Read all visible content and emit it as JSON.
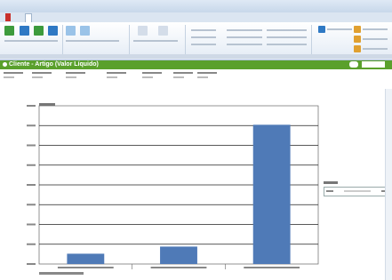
{
  "window": {
    "title": ""
  },
  "menu": {
    "tabs": [
      "",
      "",
      "",
      ""
    ]
  },
  "header": {
    "title": "Cliente - Artigo (Valor Líquido)"
  },
  "filters": [
    {
      "label": "",
      "value": ""
    },
    {
      "label": "",
      "value": ""
    },
    {
      "label": "",
      "value": ""
    },
    {
      "label": "",
      "value": ""
    },
    {
      "label": "",
      "value": ""
    },
    {
      "label": "",
      "value": ""
    },
    {
      "label": "",
      "value": ""
    }
  ],
  "slicer": {
    "label": "",
    "value": ""
  },
  "colors": {
    "brand_bar": "#5aa02c",
    "bar_fill": "#4f7ab7",
    "gridline": "#222222"
  },
  "chart_data": {
    "type": "bar",
    "title": "",
    "categories": [
      "",
      "",
      ""
    ],
    "values_relative": [
      0.065,
      0.11,
      0.88
    ],
    "gridlines": true,
    "legend": "right"
  }
}
